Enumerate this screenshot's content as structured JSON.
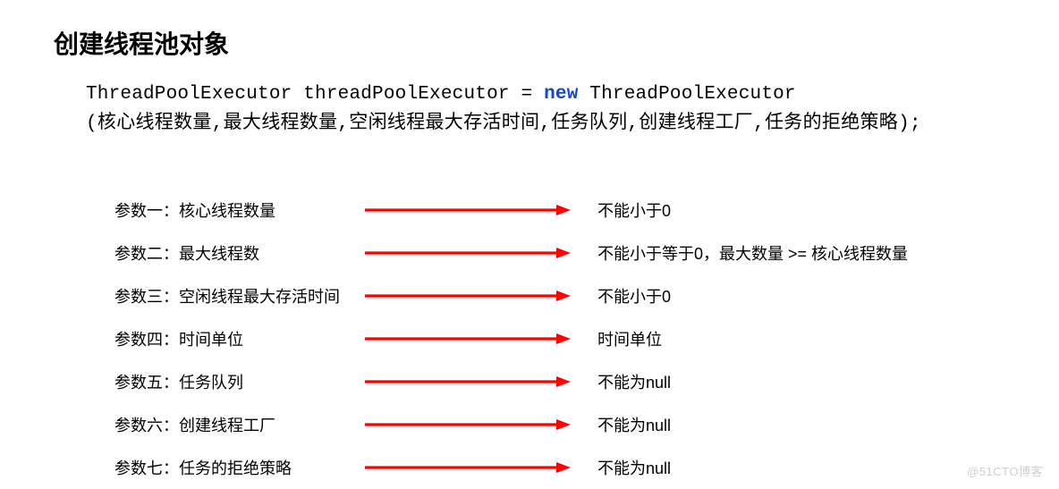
{
  "title": "创建线程池对象",
  "code": {
    "line1_prefix": "ThreadPoolExecutor threadPoolExecutor = ",
    "line1_kw": "new",
    "line1_suffix": " ThreadPoolExecutor",
    "line2": "(核心线程数量,最大线程数量,空闲线程最大存活时间,任务队列,创建线程工厂,任务的拒绝策略);"
  },
  "params": [
    {
      "label": "参数一：核心线程数量",
      "desc": "不能小于0"
    },
    {
      "label": "参数二：最大线程数",
      "desc": "不能小于等于0，最大数量 >= 核心线程数量"
    },
    {
      "label": "参数三：空闲线程最大存活时间",
      "desc": "不能小于0"
    },
    {
      "label": "参数四：时间单位",
      "desc": "时间单位"
    },
    {
      "label": "参数五：任务队列",
      "desc": "不能为null"
    },
    {
      "label": "参数六：创建线程工厂",
      "desc": "不能为null"
    },
    {
      "label": "参数七：任务的拒绝策略",
      "desc": "不能为null"
    }
  ],
  "arrow_color": "#ff0000",
  "watermark": "@51CTO博客"
}
